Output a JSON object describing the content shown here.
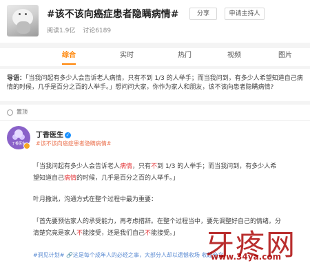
{
  "header": {
    "title": "#该不该向癌症患者隐瞒病情#",
    "share_label": "分享",
    "host_label": "申请主持人",
    "reads": "阅读1.9亿",
    "discussions": "讨论6189"
  },
  "tabs": [
    {
      "label": "综合",
      "active": true
    },
    {
      "label": "实时",
      "active": false
    },
    {
      "label": "热门",
      "active": false
    },
    {
      "label": "视频",
      "active": false
    },
    {
      "label": "图片",
      "active": false
    }
  ],
  "guide": {
    "label": "导语：",
    "text": "「当我问起有多少人会告诉老人病情，只有不到 1/3 的人举手；而当我问到，有多少人希望知道自己病情的时候，几乎是百分之百的人举手。」想问问大家，你作为家人和朋友，该不该向患者隐瞒病情?"
  },
  "pinned_label": "置顶",
  "post": {
    "avatar_text": "丁香医生",
    "author": "丁香医生",
    "tag": "#该不该向癌症患者隐瞒病情#",
    "para1": {
      "part1": "「当我问起有多少人会告诉老人",
      "hl1": "病",
      "hl1b": "情",
      "part2": "，只有",
      "hl2": "不",
      "part3": "到 1/3 的人举手；而当我问到，有多少人希望知道自己",
      "hl3": "病情",
      "part4": "的时候，几乎是百分之百的人举手。」"
    },
    "para2": "叶月撒说，沟通方式在整个过程中最为重要：",
    "para3": {
      "part1": "「首先要预估家人的承受能力，再考虑措辞。在整个过程当中，要先调整好自己的情绪。分清楚究竟是家人",
      "hl1": "不",
      "part2": "能接受，还是我们自己",
      "hl2": "不",
      "part3": "能接受。」"
    },
    "footer_tags": "#洞见计划# 🔗这是每个成年人的必经之事，大部分人却以遗憾收场 收起全文"
  },
  "watermark": {
    "big": "牙疼网",
    "url": "www.34ya.com"
  }
}
